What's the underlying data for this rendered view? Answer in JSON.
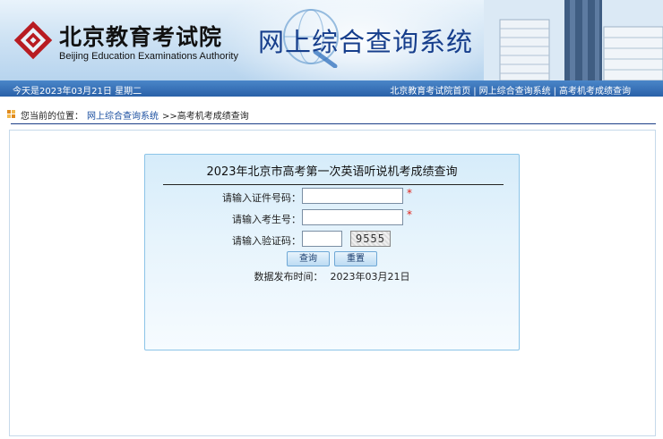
{
  "header": {
    "logo_cn": "北京教育考试院",
    "logo_en": "Beijing Education Examinations Authority",
    "system_title": "网上综合查询系统",
    "brand_color": "#b81c22",
    "title_color": "#163e8c"
  },
  "navbar": {
    "date_text": "今天是2023年03月21日  星期二",
    "links": [
      "北京教育考试院首页",
      "网上综合查询系统",
      "高考机考成绩查询"
    ],
    "separator": "|"
  },
  "breadcrumb": {
    "prefix": "您当前的位置：",
    "link": "网上综合查询系统",
    "current": ">>高考机考成绩查询"
  },
  "form": {
    "title": "2023年北京市高考第一次英语听说机考成绩查询",
    "fields": [
      {
        "label": "请输入证件号码：",
        "value": "",
        "required": true
      },
      {
        "label": "请输入考生号：",
        "value": "",
        "required": true
      },
      {
        "label": "请输入验证码：",
        "value": "",
        "required": false
      }
    ],
    "required_mark": "*",
    "captcha_text": "9555",
    "buttons": {
      "query": "查询",
      "reset": "重置"
    },
    "publish_label": "数据发布时间：",
    "publish_date": "2023年03月21日"
  },
  "icons": [
    "logo-icon",
    "globe-icon",
    "buildings-icon",
    "breadcrumb-icon"
  ]
}
